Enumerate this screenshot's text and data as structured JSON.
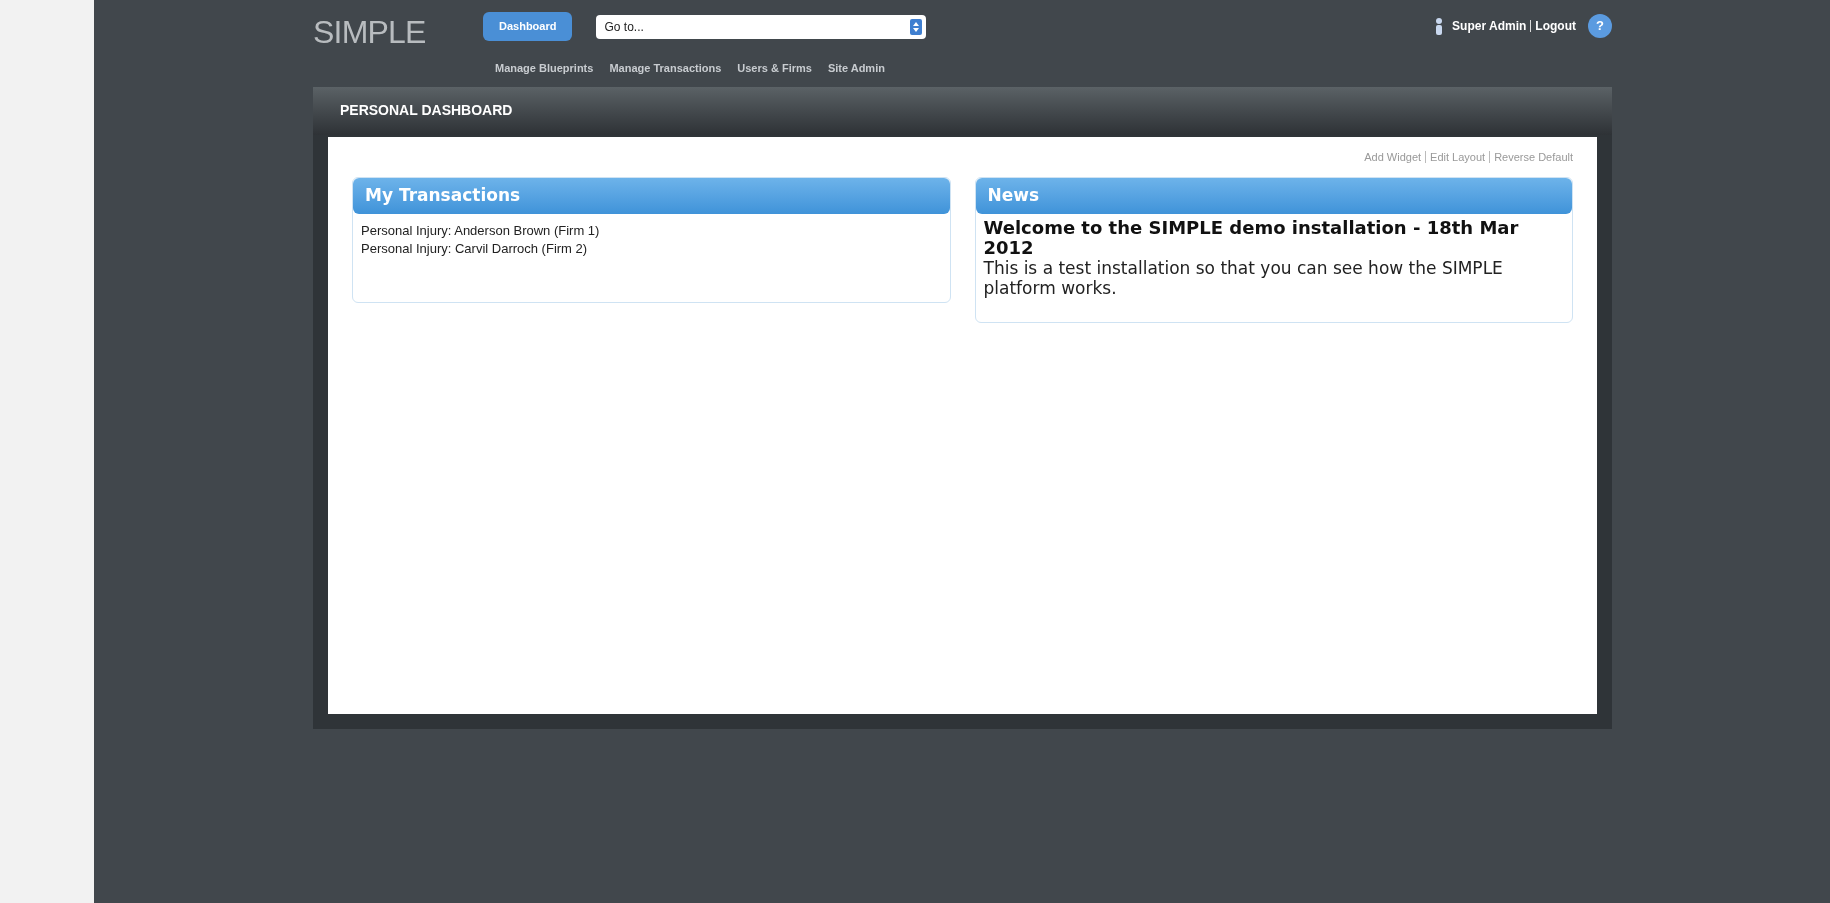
{
  "header": {
    "logo": "SIMPLE",
    "dashboard_button": "Dashboard",
    "goto_select": {
      "value": "Go to..."
    },
    "user": "Super Admin",
    "logout": "Logout",
    "help": "?"
  },
  "nav": [
    {
      "label": "Manage Blueprints"
    },
    {
      "label": "Manage Transactions"
    },
    {
      "label": "Users & Firms"
    },
    {
      "label": "Site Admin"
    }
  ],
  "page_title": "PERSONAL DASHBOARD",
  "layout_links": [
    {
      "label": "Add Widget"
    },
    {
      "label": "Edit Layout"
    },
    {
      "label": "Reverse Default"
    }
  ],
  "widgets": [
    {
      "kind": "list",
      "title": "My Transactions",
      "items": [
        "Personal Injury: Anderson Brown (Firm 1)",
        "Personal Injury: Carvil Darroch (Firm 2)"
      ]
    },
    {
      "kind": "news",
      "title": "News",
      "headline": "Welcome to the SIMPLE demo installation - 18th Mar 2012",
      "body": "This is a test installation so that you can see how the SIMPLE platform works."
    }
  ]
}
